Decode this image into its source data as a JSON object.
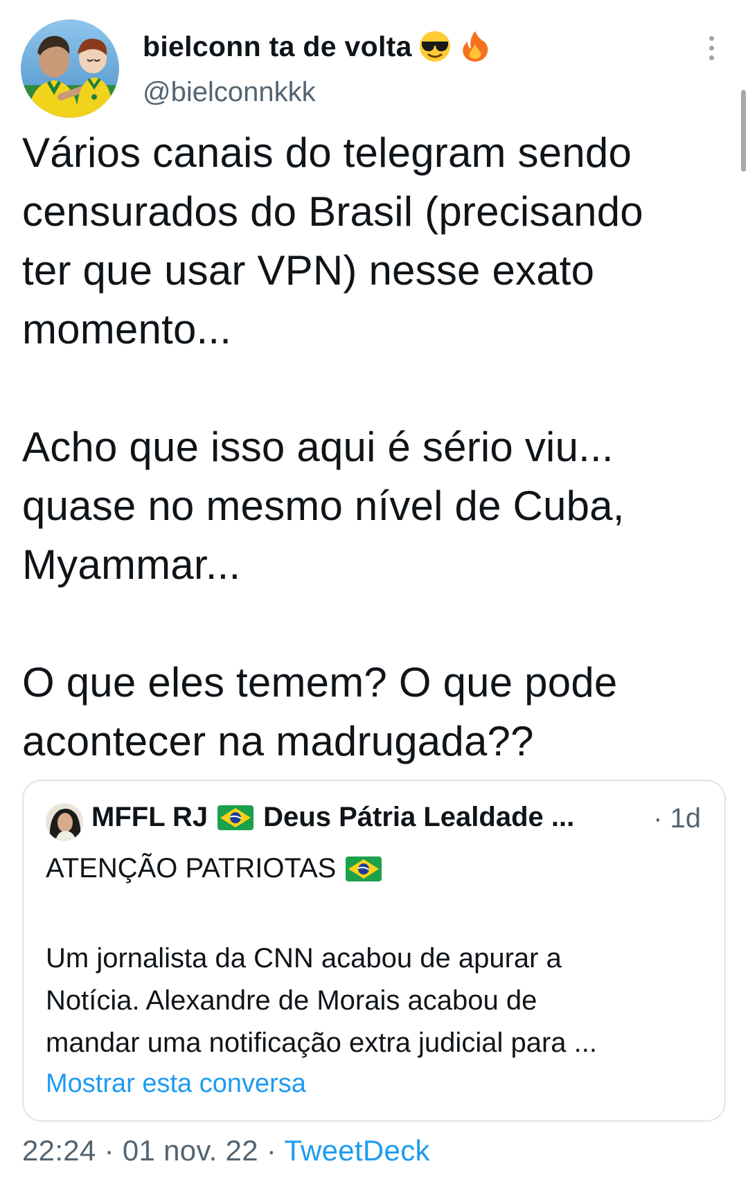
{
  "author": {
    "display_name": "bielconn ta de volta",
    "handle": "@bielconnkkk",
    "avatar_icon": "user-avatar-photo",
    "name_emojis": [
      "sunglasses-face-emoji",
      "fire-emoji"
    ]
  },
  "tweet": {
    "paragraphs": [
      [
        "Vários canais do telegram sendo",
        "censurados do Brasil (precisando",
        "ter que usar VPN) nesse exato",
        "momento..."
      ],
      [
        "Acho que isso aqui é sério viu...",
        "quase no mesmo nível de Cuba,",
        "Myammar..."
      ],
      [
        "O que eles temem? O que pode",
        "acontecer na madrugada??"
      ]
    ]
  },
  "quote": {
    "name_part1": "MFFL RJ",
    "name_part2": "Deus Pátria Lealdade ...",
    "time": "· 1d",
    "title": "ATENÇÃO PATRIOTAS",
    "body": [
      "Um jornalista da CNN acabou de apurar a",
      "Notícia. Alexandre de Morais acabou de",
      "mandar uma notificação extra judicial para ..."
    ],
    "show_thread": "Mostrar esta conversa",
    "flag_icon": "brazil-flag-emoji"
  },
  "meta": {
    "time": "22:24",
    "sep1": " · ",
    "date": "01 nov. 22",
    "sep2": " · ",
    "source": "TweetDeck"
  },
  "colors": {
    "text": "#0f1419",
    "secondary": "#536471",
    "link": "#1d9bf0",
    "border": "#dfe4e8"
  }
}
